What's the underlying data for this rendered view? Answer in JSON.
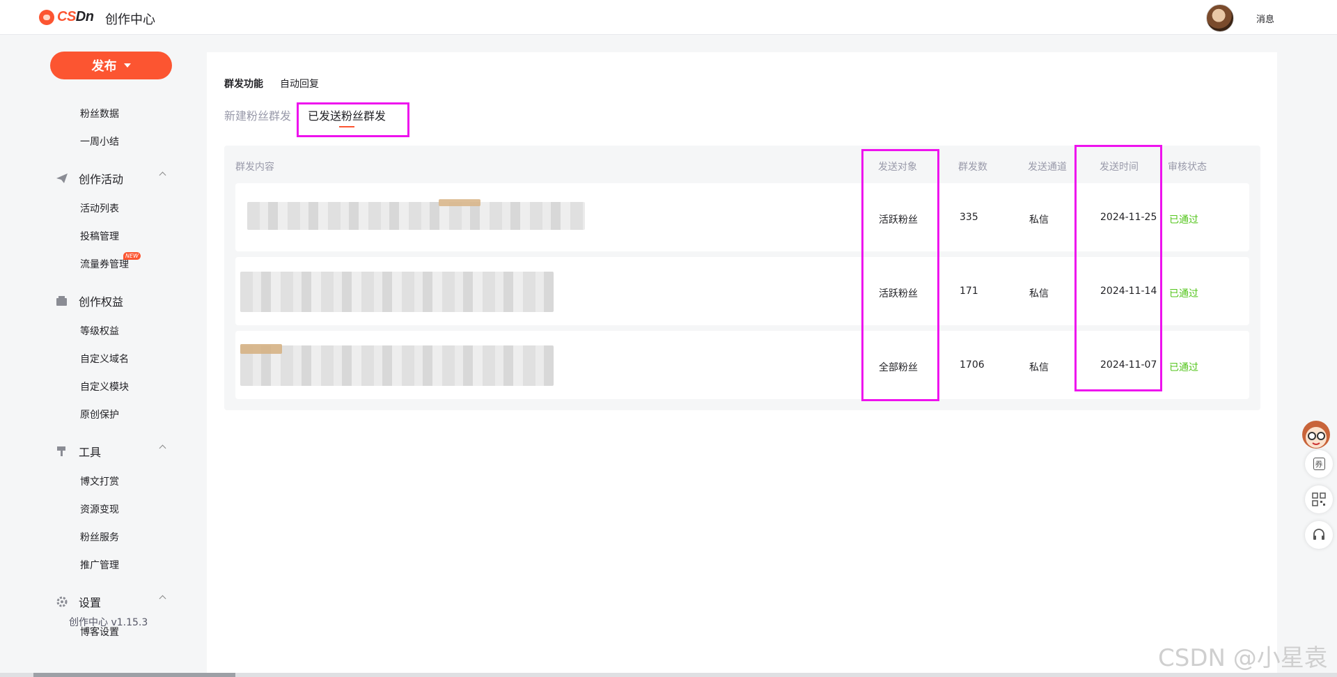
{
  "header": {
    "brand_prefix": "CS",
    "brand_suffix": "Dn",
    "title": "创作中心",
    "messages": "消息"
  },
  "sidebar": {
    "publish_label": "发布",
    "top_items": [
      "粉丝数据",
      "一周小结"
    ],
    "groups": [
      {
        "label": "创作活动",
        "icon": "paper-plane-icon",
        "items": [
          "活动列表",
          "投稿管理",
          "流量券管理"
        ]
      },
      {
        "label": "创作权益",
        "icon": "wallet-icon",
        "items": [
          "等级权益",
          "自定义域名",
          "自定义模块",
          "原创保护"
        ]
      },
      {
        "label": "工具",
        "icon": "hammer-icon",
        "items": [
          "博文打赏",
          "资源变现",
          "粉丝服务",
          "推广管理"
        ]
      },
      {
        "label": "设置",
        "icon": "gear-icon",
        "items": [
          "博客设置"
        ]
      }
    ],
    "new_badge": "NEW",
    "version": "创作中心 v1.15.3"
  },
  "tabs": {
    "top": [
      "群发功能",
      "自动回复"
    ],
    "sub": [
      "新建粉丝群发",
      "已发送粉丝群发"
    ]
  },
  "table": {
    "columns": [
      "群发内容",
      "发送对象",
      "群发数",
      "发送通道",
      "发送时间",
      "审核状态"
    ],
    "rows": [
      {
        "target": "活跃粉丝",
        "count": "335",
        "channel": "私信",
        "time": "2024-11-25",
        "status": "已通过"
      },
      {
        "target": "活跃粉丝",
        "count": "171",
        "channel": "私信",
        "time": "2024-11-14",
        "status": "已通过"
      },
      {
        "target": "全部粉丝",
        "count": "1706",
        "channel": "私信",
        "time": "2024-11-07",
        "status": "已通过"
      }
    ]
  },
  "float_tools": {
    "coupon_label": "券"
  },
  "watermark": "CSDN @小星袁",
  "colors": {
    "accent": "#fc5531",
    "highlight": "#ee12ee",
    "success": "#52c41a"
  }
}
